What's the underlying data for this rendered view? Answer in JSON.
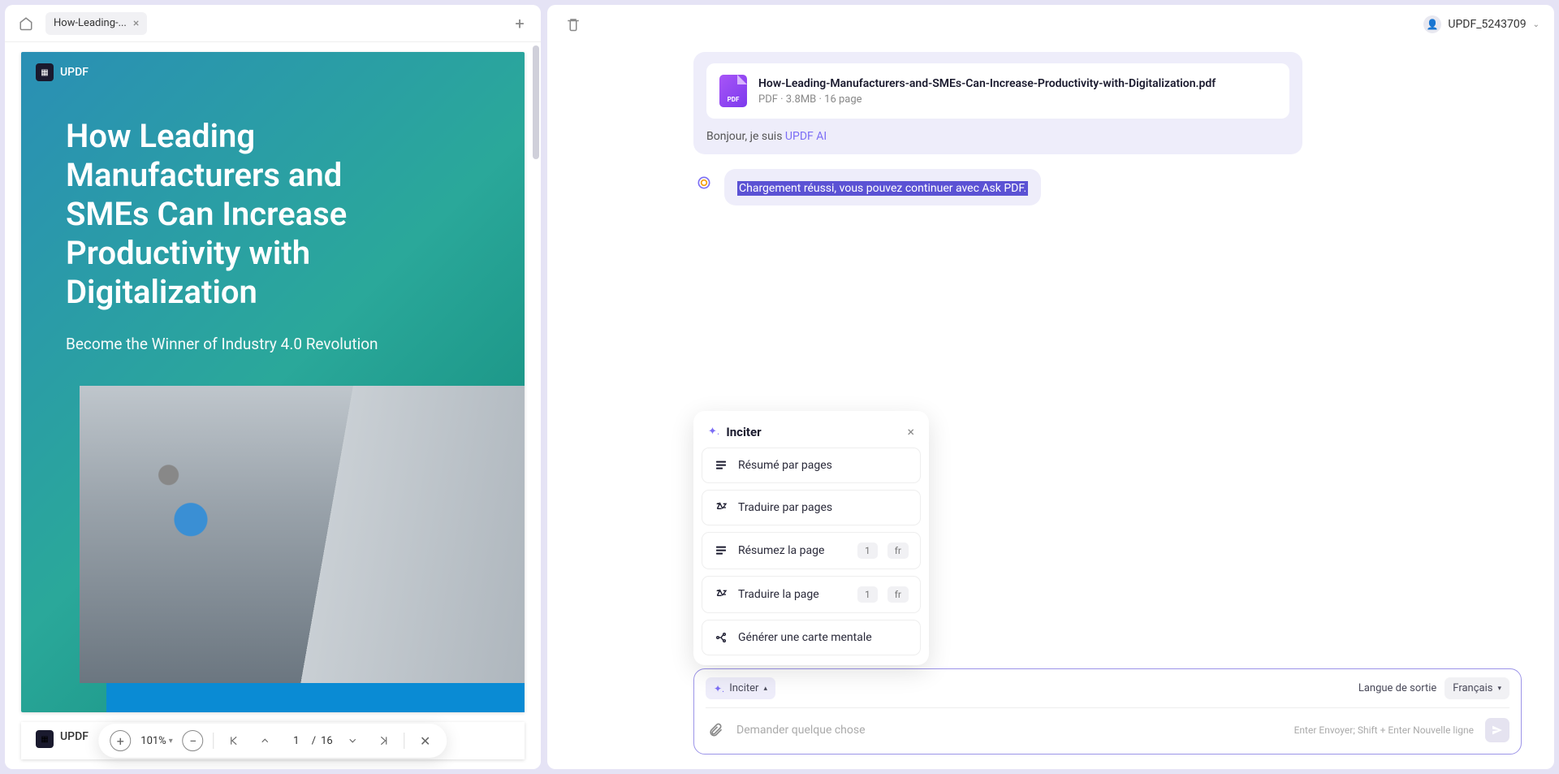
{
  "tabs": {
    "active_title": "How-Leading-..."
  },
  "user": {
    "name": "UPDF_5243709"
  },
  "pdf": {
    "brand": "UPDF",
    "title": "How Leading Manufacturers and SMEs Can Increase Productivity with Digitalization",
    "subtitle": "Become the Winner of Industry 4.0 Revolution"
  },
  "toolbar": {
    "zoom": "101%",
    "page_current": "1",
    "page_total": "16"
  },
  "chat": {
    "file_name": "How-Leading-Manufacturers-and-SMEs-Can-Increase-Productivity-with-Digitalization.pdf",
    "file_type": "PDF",
    "file_size": "3.8MB",
    "file_pages": "16 page",
    "greeting_prefix": "Bonjour, je suis ",
    "greeting_link": "UPDF AI",
    "status": "Chargement réussi, vous pouvez continuer avec Ask PDF."
  },
  "popup": {
    "title": "Inciter",
    "items": {
      "resume_pages": "Résumé par pages",
      "traduire_pages": "Traduire par pages",
      "resumez_page": "Résumez la page",
      "traduire_page": "Traduire la page",
      "mindmap": "Générer une carte mentale"
    },
    "badge_page": "1",
    "badge_lang": "fr"
  },
  "input": {
    "inciter_label": "Inciter",
    "lang_label": "Langue de sortie",
    "lang_value": "Français",
    "placeholder": "Demander quelque chose",
    "hint": "Enter Envoyer; Shift + Enter Nouvelle ligne"
  }
}
